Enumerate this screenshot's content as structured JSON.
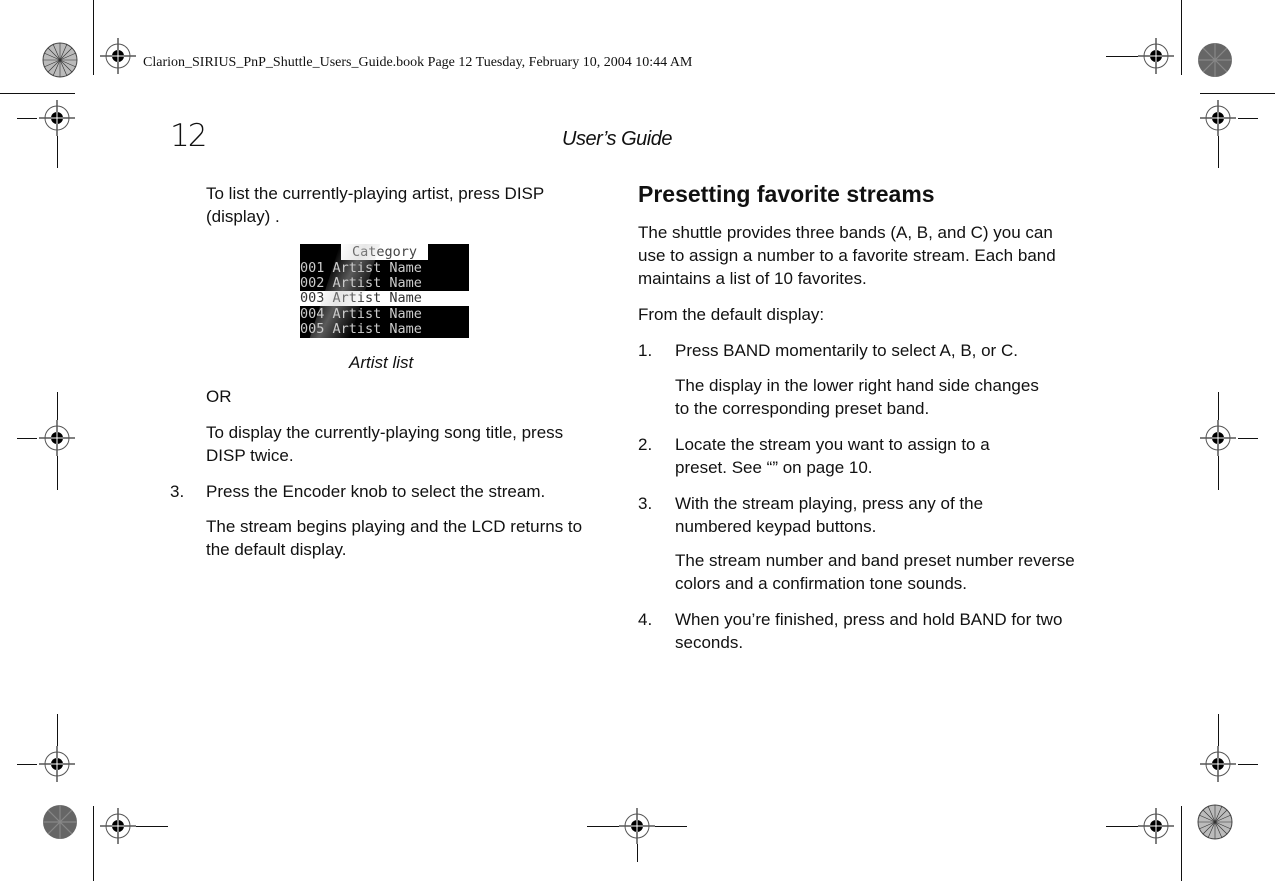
{
  "slug": "Clarion_SIRIUS_PnP_Shuttle_Users_Guide.book  Page 12  Tuesday, February 10, 2004  10:44 AM",
  "header": {
    "page_number": "12",
    "running_head": "User’s Guide"
  },
  "left_column": {
    "intro": "To list the currently-playing artist, press DISP (display) .",
    "lcd": {
      "title": "Category",
      "rows": [
        "001 Artist Name",
        "002 Artist Name",
        "003 Artist Name",
        "004 Artist Name",
        "005 Artist Name"
      ],
      "highlighted_row": 3
    },
    "caption": "Artist list",
    "or": "OR",
    "song_title": "To display the currently-playing song title, press DISP twice.",
    "step3_num": "3.",
    "step3": "Press the Encoder knob to select the stream.",
    "step3_result": "The stream begins playing and the LCD returns to the default display."
  },
  "right_column": {
    "heading": "Presetting favorite streams",
    "intro": "The shuttle provides three bands (A, B, and C) you can use to assign a number to a favorite stream. Each band maintains a list of 10 favorites.",
    "from_default": "From the default display:",
    "steps": [
      {
        "num": "1.",
        "text": "Press BAND momentarily to select A, B, or C.",
        "result": "The display in the lower right hand side changes to the corresponding preset band."
      },
      {
        "num": "2.",
        "text": "Locate the stream you want to assign to a preset. See “” on page 10.",
        "result": ""
      },
      {
        "num": "3.",
        "text": "With the stream playing, press any of the numbered keypad buttons.",
        "result": "The stream number and band preset number reverse colors and a confirmation tone sounds."
      },
      {
        "num": "4.",
        "text": "When you’re finished, press and hold BAND for two seconds.",
        "result": ""
      }
    ]
  }
}
